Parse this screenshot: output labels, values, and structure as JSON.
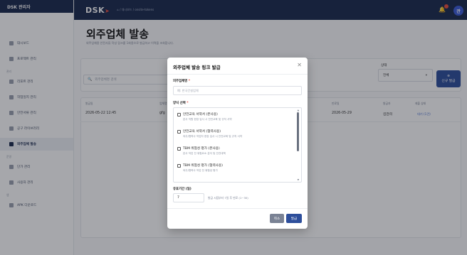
{
  "app": {
    "title": "DSK 관리자"
  },
  "sidebar": {
    "items": [
      {
        "label": "대시보드"
      },
      {
        "label": "프로젝트 관리"
      },
      {
        "label": "리포트 관리"
      },
      {
        "label": "작업일지 관리"
      },
      {
        "label": "안전서류 관리"
      },
      {
        "label": "공구 라이브러리"
      },
      {
        "label": "외주업체 발송"
      },
      {
        "label": "단가 관리"
      },
      {
        "label": "사용자 관리"
      },
      {
        "label": "APK 다운로드"
      }
    ],
    "sections": [
      "관리",
      "운영",
      "앱"
    ]
  },
  "topbar": {
    "logo": "DSK",
    "breadcrumb": "⌂ / 대시보드 / onsite-tokens"
  },
  "page": {
    "title": "외주업체 발송",
    "subtitle": "외주업체용 안전서류 작성 링크를 1회용으로 발급하고 이력을 조회합니다."
  },
  "filters": {
    "search_placeholder": "외주업체명 검색",
    "status_label": "상태",
    "status_value": "전체",
    "new_button": [
      "신규 발급"
    ]
  },
  "table": {
    "headers": [
      "발급일",
      "업체명",
      "만료일",
      "발급자",
      "제출 상태"
    ],
    "rows": [
      {
        "issued": "2026-05-22 12:45",
        "company": "gfg",
        "expires": "2026-05-29",
        "issuer": "김관리",
        "status": "대기 (1건)"
      }
    ]
  },
  "modal": {
    "title": "외주업체 발송 링크 발급",
    "company_label": "외주업체명",
    "company_placeholder": "예: 한국건설업체",
    "forms_label": "양식 선택",
    "forms": [
      {
        "name": "안전교육 서약서 (본사용)",
        "desc": "본사 직원 현장 입사 시 안전교육 및 규칙 서약"
      },
      {
        "name": "안전교육 서약서 (협력사용)",
        "desc": "외주/협력사 작업자 현장 입사 시 안전교육 및 규칙 서약"
      },
      {
        "name": "TBM 위험성 평가 (본사용)",
        "desc": "본사 작업 전 위험요소 분석 및 안전대책"
      },
      {
        "name": "TBM 위험성 평가 (협력사용)",
        "desc": "외주/협력사 작업 전 위험성 평가"
      }
    ],
    "period_label": "유효기간 (일)",
    "period_value": "7",
    "period_hint": "발급 시점부터 7일 후 만료 (1~30)",
    "cancel": "취소",
    "submit": "발급",
    "required_mark": "*"
  },
  "colors": {
    "brand_navy": "#19294d",
    "primary": "#2d4e9b",
    "danger": "#e74c3c",
    "muted": "#7a8294"
  },
  "badges": {
    "notification_count": "1",
    "avatar_initial": "관"
  }
}
